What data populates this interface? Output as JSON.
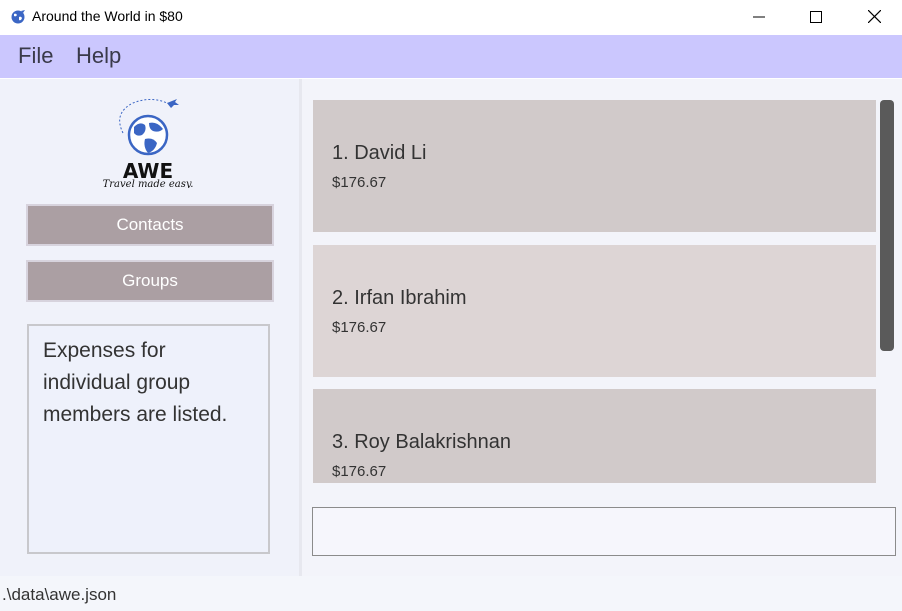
{
  "window": {
    "title": "Around the World in $80",
    "icon": "globe-icon"
  },
  "menu": {
    "file": "File",
    "help": "Help"
  },
  "sidebar": {
    "logo_title": "AWE",
    "logo_tagline": "Travel made easy.",
    "contacts_label": "Contacts",
    "groups_label": "Groups",
    "info_text": "Expenses for individual group members are listed."
  },
  "expenses": [
    {
      "name": "1. David Li",
      "amount": "$176.67"
    },
    {
      "name": "2. Irfan Ibrahim",
      "amount": "$176.67"
    },
    {
      "name": "3. Roy Balakrishnan",
      "amount": "$176.67"
    }
  ],
  "colors": {
    "menubar": "#cbc7fe",
    "card_a": "#d1caca",
    "card_b": "#ddd5d5",
    "nav_button": "#ab9fa3",
    "logo_globe": "#3b66c4"
  },
  "result_display": "",
  "status": {
    "path": ".\\data\\awe.json"
  }
}
